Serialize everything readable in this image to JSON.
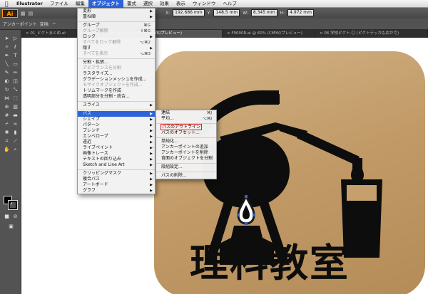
{
  "menubar": {
    "app": "Illustrator",
    "items": [
      "ファイル",
      "編集",
      "オブジェクト",
      "書式",
      "選択",
      "効果",
      "表示",
      "ウィンドウ",
      "ヘルプ"
    ],
    "active_index": 2
  },
  "appbar": {
    "logo": "Ai",
    "fields": {
      "x_label": "X:",
      "x_value": "192.686 mm",
      "y_label": "Y:",
      "y_value": "148.5 mm",
      "w_label": "W:",
      "w_value": "8.345 mm",
      "h_label": "H:",
      "h_value": "4.972 mm"
    }
  },
  "ctrlbar": {
    "label": "アンカーポイント",
    "label2": "変換:"
  },
  "doc_tabs": [
    "× 01_ビクトまとめ.ai* @ 31.67% (C",
    "文集伝記.ai* @ 600% (CMYK/プレビュー)",
    "× F9000R.ai @ 60% (CMYK/プレビュー)",
    "× 06 学校ピクト-〇 (ピクトデッカも広かで)"
  ],
  "object_menu": {
    "items": [
      {
        "label": "変形",
        "arrow": true
      },
      {
        "label": "重ね順",
        "arrow": true
      },
      {
        "sep": true
      },
      {
        "label": "グループ",
        "shortcut": "⌘G"
      },
      {
        "label": "グループ解除",
        "shortcut": "⇧⌘G",
        "disabled": true
      },
      {
        "label": "ロック",
        "arrow": true
      },
      {
        "label": "すべてをロック解除",
        "shortcut": "⌥⌘2",
        "disabled": true
      },
      {
        "label": "隠す",
        "arrow": true
      },
      {
        "label": "すべてを表示",
        "shortcut": "⌥⌘3",
        "disabled": true
      },
      {
        "sep": true
      },
      {
        "label": "分割・拡張..."
      },
      {
        "label": "アピアランスを分割",
        "disabled": true
      },
      {
        "label": "ラスタライズ..."
      },
      {
        "label": "グラデーションメッシュを作成..."
      },
      {
        "label": "モザイクオブジェクトを作成...",
        "disabled": true
      },
      {
        "label": "トリムマークを作成"
      },
      {
        "label": "透明部分を分割・統合..."
      },
      {
        "sep": true
      },
      {
        "label": "スライス",
        "arrow": true
      },
      {
        "sep": true
      },
      {
        "label": "パス",
        "arrow": true,
        "highlighted": true
      },
      {
        "label": "シェイプ",
        "arrow": true
      },
      {
        "label": "パターン",
        "arrow": true
      },
      {
        "label": "ブレンド",
        "arrow": true
      },
      {
        "label": "エンベロープ",
        "arrow": true
      },
      {
        "label": "遠近",
        "arrow": true
      },
      {
        "label": "ライブペイント",
        "arrow": true
      },
      {
        "label": "画像トレース",
        "arrow": true
      },
      {
        "label": "テキストの回り込み",
        "arrow": true
      },
      {
        "label": "Sketch and Line Art",
        "arrow": true
      },
      {
        "sep": true
      },
      {
        "label": "クリッピングマスク",
        "arrow": true
      },
      {
        "label": "複合パス",
        "arrow": true
      },
      {
        "label": "アートボード",
        "arrow": true
      },
      {
        "label": "グラフ",
        "arrow": true
      }
    ]
  },
  "path_menu": {
    "items": [
      {
        "label": "連結",
        "shortcut": "⌘J"
      },
      {
        "label": "平均...",
        "shortcut": "⌥⌘J"
      },
      {
        "sep": true
      },
      {
        "label": "パスのアウトライン",
        "boxed": true
      },
      {
        "label": "パスのオフセット..."
      },
      {
        "sep": true
      },
      {
        "label": "単純化..."
      },
      {
        "label": "アンカーポイントの追加"
      },
      {
        "label": "アンカーポイントを削除"
      },
      {
        "label": "背面のオブジェクトを分割"
      },
      {
        "sep": true
      },
      {
        "label": "段組設定..."
      },
      {
        "sep": true
      },
      {
        "label": "パスの削除..."
      }
    ]
  },
  "artwork": {
    "title": "理科教室",
    "bg_color": "#c6a06c",
    "ink_color": "#0d0d0d"
  }
}
